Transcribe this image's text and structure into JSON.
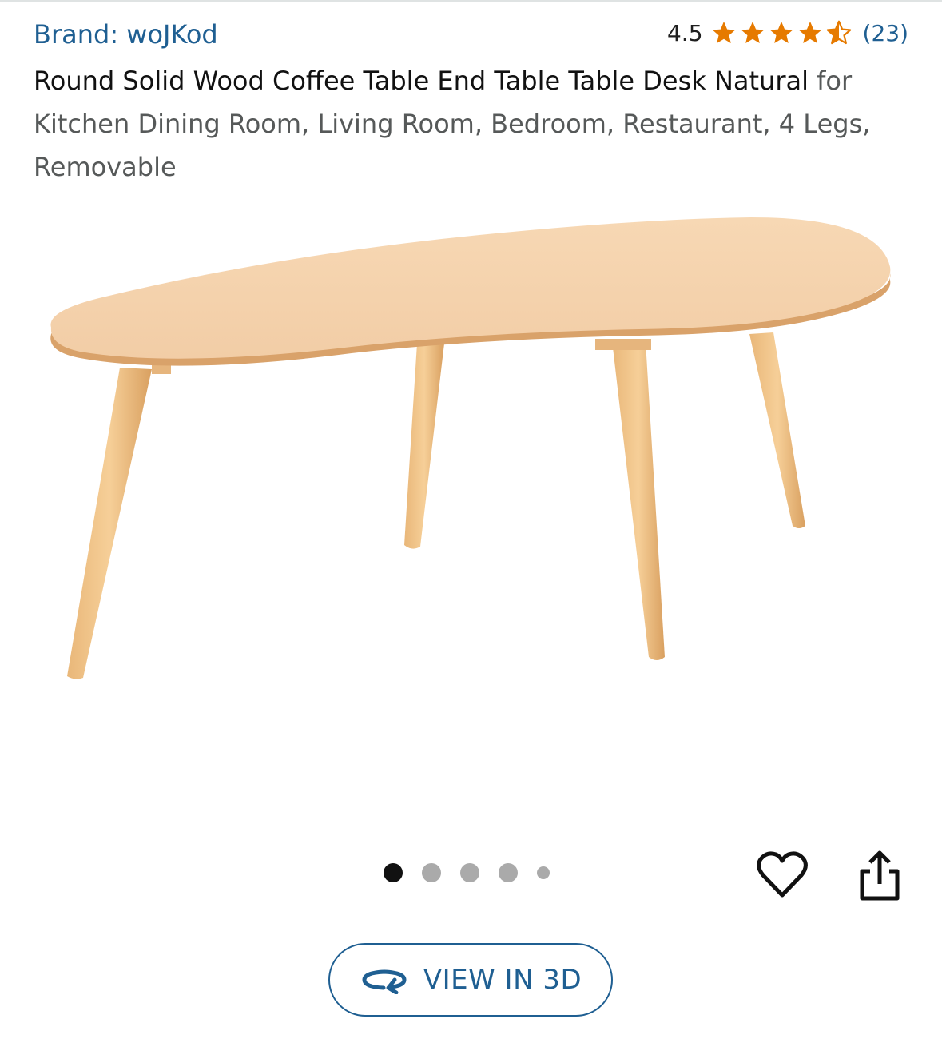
{
  "product": {
    "brand": "Brand: woJKod",
    "rating": "4.5",
    "stars": [
      1,
      1,
      1,
      1,
      0.5
    ],
    "review_count": "(23)",
    "title_main": "Round Solid Wood Coffee Table End Table Table Desk Natural",
    "title_sub": " for Kitchen Dining Room, Living Room, Bedroom, Restaurant, 4 Legs, Removable",
    "image_icon": "coffee-table-photo"
  },
  "gallery": {
    "dot_count": 5,
    "active_index": 0
  },
  "actions": {
    "wishlist_icon": "heart-icon",
    "share_icon": "share-icon",
    "view3d_label": "VIEW IN 3D",
    "view3d_icon": "rotate-3d-icon"
  },
  "colors": {
    "link": "#1f5f92",
    "star": "#e67a00",
    "text": "#111111",
    "subtext": "#565959"
  }
}
